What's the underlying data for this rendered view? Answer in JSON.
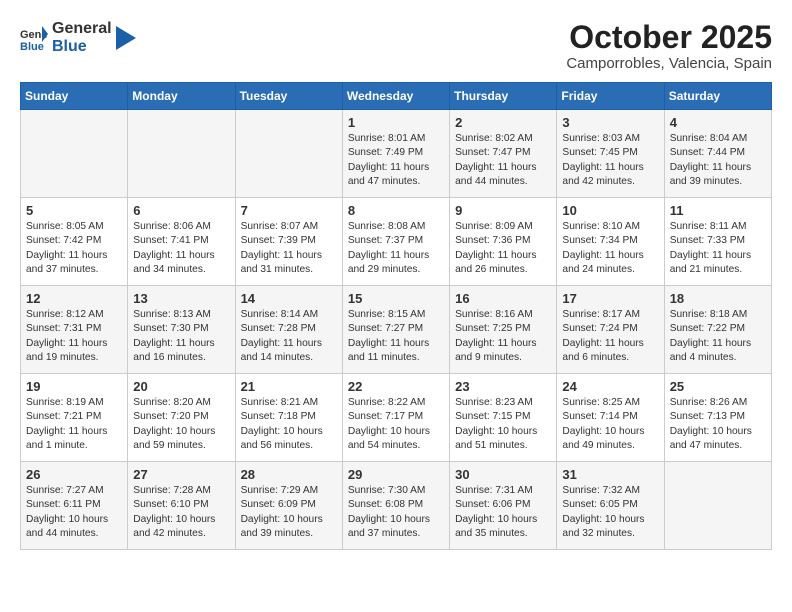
{
  "logo": {
    "general": "General",
    "blue": "Blue"
  },
  "title": "October 2025",
  "location": "Camporrobles, Valencia, Spain",
  "weekdays": [
    "Sunday",
    "Monday",
    "Tuesday",
    "Wednesday",
    "Thursday",
    "Friday",
    "Saturday"
  ],
  "weeks": [
    [
      {
        "day": "",
        "info": ""
      },
      {
        "day": "",
        "info": ""
      },
      {
        "day": "",
        "info": ""
      },
      {
        "day": "1",
        "info": "Sunrise: 8:01 AM\nSunset: 7:49 PM\nDaylight: 11 hours and 47 minutes."
      },
      {
        "day": "2",
        "info": "Sunrise: 8:02 AM\nSunset: 7:47 PM\nDaylight: 11 hours and 44 minutes."
      },
      {
        "day": "3",
        "info": "Sunrise: 8:03 AM\nSunset: 7:45 PM\nDaylight: 11 hours and 42 minutes."
      },
      {
        "day": "4",
        "info": "Sunrise: 8:04 AM\nSunset: 7:44 PM\nDaylight: 11 hours and 39 minutes."
      }
    ],
    [
      {
        "day": "5",
        "info": "Sunrise: 8:05 AM\nSunset: 7:42 PM\nDaylight: 11 hours and 37 minutes."
      },
      {
        "day": "6",
        "info": "Sunrise: 8:06 AM\nSunset: 7:41 PM\nDaylight: 11 hours and 34 minutes."
      },
      {
        "day": "7",
        "info": "Sunrise: 8:07 AM\nSunset: 7:39 PM\nDaylight: 11 hours and 31 minutes."
      },
      {
        "day": "8",
        "info": "Sunrise: 8:08 AM\nSunset: 7:37 PM\nDaylight: 11 hours and 29 minutes."
      },
      {
        "day": "9",
        "info": "Sunrise: 8:09 AM\nSunset: 7:36 PM\nDaylight: 11 hours and 26 minutes."
      },
      {
        "day": "10",
        "info": "Sunrise: 8:10 AM\nSunset: 7:34 PM\nDaylight: 11 hours and 24 minutes."
      },
      {
        "day": "11",
        "info": "Sunrise: 8:11 AM\nSunset: 7:33 PM\nDaylight: 11 hours and 21 minutes."
      }
    ],
    [
      {
        "day": "12",
        "info": "Sunrise: 8:12 AM\nSunset: 7:31 PM\nDaylight: 11 hours and 19 minutes."
      },
      {
        "day": "13",
        "info": "Sunrise: 8:13 AM\nSunset: 7:30 PM\nDaylight: 11 hours and 16 minutes."
      },
      {
        "day": "14",
        "info": "Sunrise: 8:14 AM\nSunset: 7:28 PM\nDaylight: 11 hours and 14 minutes."
      },
      {
        "day": "15",
        "info": "Sunrise: 8:15 AM\nSunset: 7:27 PM\nDaylight: 11 hours and 11 minutes."
      },
      {
        "day": "16",
        "info": "Sunrise: 8:16 AM\nSunset: 7:25 PM\nDaylight: 11 hours and 9 minutes."
      },
      {
        "day": "17",
        "info": "Sunrise: 8:17 AM\nSunset: 7:24 PM\nDaylight: 11 hours and 6 minutes."
      },
      {
        "day": "18",
        "info": "Sunrise: 8:18 AM\nSunset: 7:22 PM\nDaylight: 11 hours and 4 minutes."
      }
    ],
    [
      {
        "day": "19",
        "info": "Sunrise: 8:19 AM\nSunset: 7:21 PM\nDaylight: 11 hours and 1 minute."
      },
      {
        "day": "20",
        "info": "Sunrise: 8:20 AM\nSunset: 7:20 PM\nDaylight: 10 hours and 59 minutes."
      },
      {
        "day": "21",
        "info": "Sunrise: 8:21 AM\nSunset: 7:18 PM\nDaylight: 10 hours and 56 minutes."
      },
      {
        "day": "22",
        "info": "Sunrise: 8:22 AM\nSunset: 7:17 PM\nDaylight: 10 hours and 54 minutes."
      },
      {
        "day": "23",
        "info": "Sunrise: 8:23 AM\nSunset: 7:15 PM\nDaylight: 10 hours and 51 minutes."
      },
      {
        "day": "24",
        "info": "Sunrise: 8:25 AM\nSunset: 7:14 PM\nDaylight: 10 hours and 49 minutes."
      },
      {
        "day": "25",
        "info": "Sunrise: 8:26 AM\nSunset: 7:13 PM\nDaylight: 10 hours and 47 minutes."
      }
    ],
    [
      {
        "day": "26",
        "info": "Sunrise: 7:27 AM\nSunset: 6:11 PM\nDaylight: 10 hours and 44 minutes."
      },
      {
        "day": "27",
        "info": "Sunrise: 7:28 AM\nSunset: 6:10 PM\nDaylight: 10 hours and 42 minutes."
      },
      {
        "day": "28",
        "info": "Sunrise: 7:29 AM\nSunset: 6:09 PM\nDaylight: 10 hours and 39 minutes."
      },
      {
        "day": "29",
        "info": "Sunrise: 7:30 AM\nSunset: 6:08 PM\nDaylight: 10 hours and 37 minutes."
      },
      {
        "day": "30",
        "info": "Sunrise: 7:31 AM\nSunset: 6:06 PM\nDaylight: 10 hours and 35 minutes."
      },
      {
        "day": "31",
        "info": "Sunrise: 7:32 AM\nSunset: 6:05 PM\nDaylight: 10 hours and 32 minutes."
      },
      {
        "day": "",
        "info": ""
      }
    ]
  ]
}
